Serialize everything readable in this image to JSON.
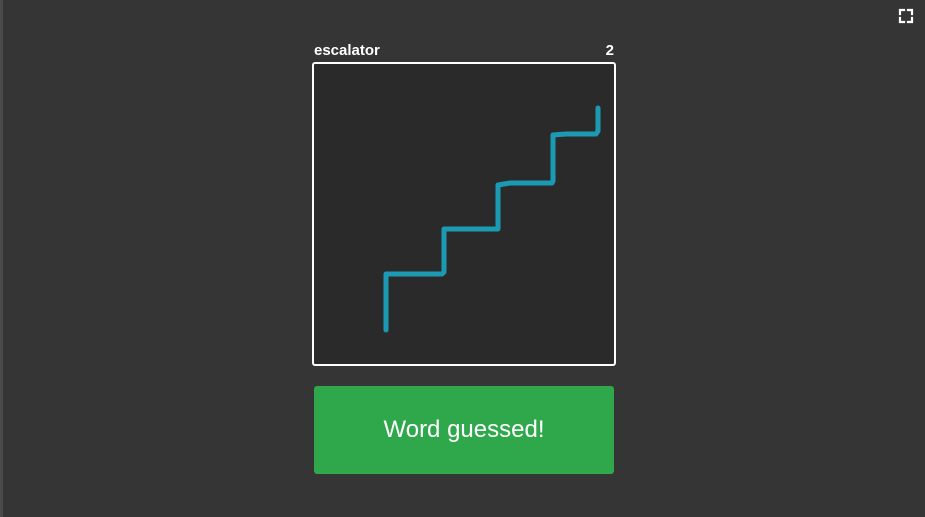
{
  "header": {
    "word": "escalator",
    "count": "2"
  },
  "drawing": {
    "stroke_color": "#1c9ab4",
    "description_icon": "staircase-drawing"
  },
  "actions": {
    "guess_label": "Word guessed!",
    "guess_color": "#2ea84a"
  },
  "toolbar": {
    "fullscreen_icon": "fullscreen-icon"
  }
}
